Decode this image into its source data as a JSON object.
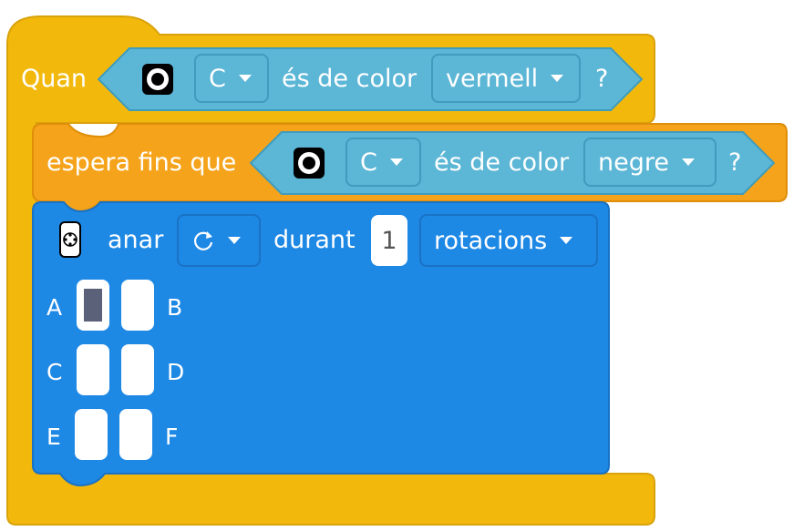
{
  "when_block": {
    "label": "Quan",
    "condition": {
      "port": "C",
      "text": "és de color",
      "color": "vermell",
      "question": "?"
    }
  },
  "wait_block": {
    "label": "espera fins que",
    "condition": {
      "port": "C",
      "text": "és de color",
      "color": "negre",
      "question": "?"
    }
  },
  "motor_block": {
    "action": "anar",
    "direction_icon": "clockwise-icon",
    "text": "durant",
    "amount": "1",
    "unit": "rotacions",
    "ports": [
      {
        "left": "A",
        "right": "B"
      },
      {
        "left": "C",
        "right": "D"
      },
      {
        "left": "E",
        "right": "F"
      }
    ],
    "selected_port": "A"
  },
  "colors": {
    "events_yellow": "#f2b90c",
    "control_orange": "#f5a31a",
    "sensor_cyan": "#5cb6d6",
    "motor_blue": "#1e88e5"
  }
}
